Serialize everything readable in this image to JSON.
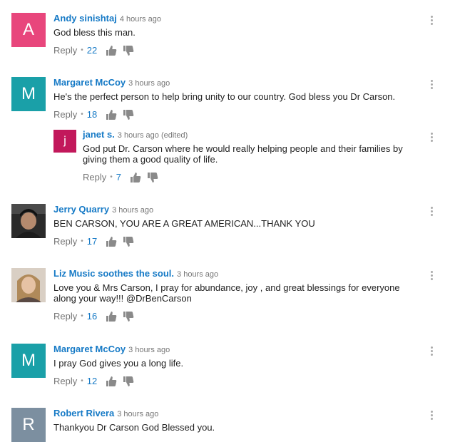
{
  "comments": [
    {
      "author": "Andy sinishtaj",
      "time": "4 hours ago",
      "text": "God bless this man.",
      "reply_label": "Reply",
      "likes": "22",
      "avatar_letter": "A",
      "avatar_color": "#e8467c"
    },
    {
      "author": "Margaret McCoy",
      "time": "3 hours ago",
      "text": "He's the perfect person to help bring unity to our country. God bless you Dr Carson.",
      "reply_label": "Reply",
      "likes": "18",
      "avatar_letter": "M",
      "avatar_color": "#1aa0a8"
    },
    {
      "author": "janet s.",
      "time": "3 hours ago (edited)",
      "text": "God put Dr. Carson where he would really helping people and their families by giving them a good quality of life.",
      "reply_label": "Reply",
      "likes": "7",
      "avatar_letter": "j",
      "avatar_color": "#c2185b"
    },
    {
      "author": "Jerry Quarry",
      "time": "3 hours ago",
      "text": "BEN CARSON, YOU ARE A GREAT AMERICAN...THANK YOU",
      "reply_label": "Reply",
      "likes": "17"
    },
    {
      "author": "Liz Music soothes the soul.",
      "time": "3 hours ago",
      "text": "Love you & Mrs Carson, I pray for abundance, joy , and great blessings for everyone along your way!!! @DrBenCarson",
      "reply_label": "Reply",
      "likes": "16"
    },
    {
      "author": "Margaret McCoy",
      "time": "3 hours ago",
      "text": "I pray God gives you a long life.",
      "reply_label": "Reply",
      "likes": "12",
      "avatar_letter": "M",
      "avatar_color": "#1aa0a8"
    },
    {
      "author": "Robert Rivera",
      "time": "3 hours ago",
      "text": "Thankyou Dr Carson God Blessed you.",
      "avatar_letter": "R",
      "avatar_color": "#7c8fa0"
    }
  ],
  "icons": {
    "like": "thumbs-up-icon",
    "dislike": "thumbs-down-icon",
    "menu": "more-vertical-icon"
  }
}
